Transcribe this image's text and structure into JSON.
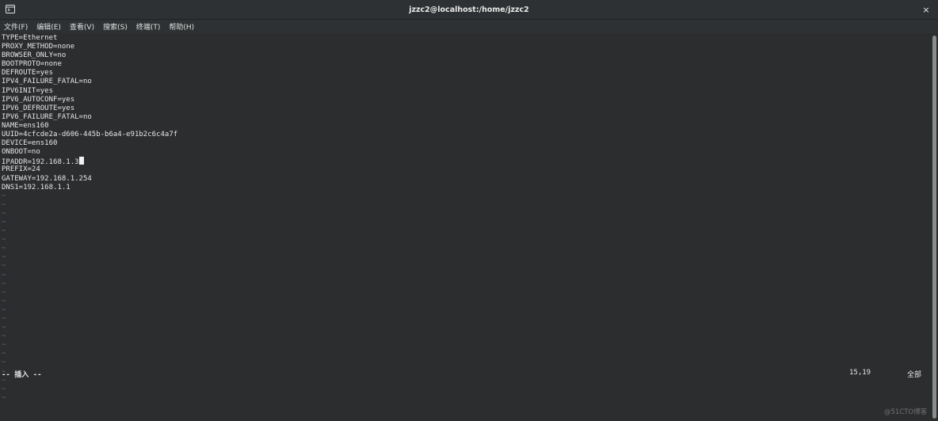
{
  "window": {
    "title": "jzzc2@localhost:/home/jzzc2",
    "close_glyph": "×",
    "icon": "terminal-icon"
  },
  "menu": [
    "文件(F)",
    "编辑(E)",
    "查看(V)",
    "搜索(S)",
    "终端(T)",
    "帮助(H)"
  ],
  "editor": {
    "lines": [
      "TYPE=Ethernet",
      "PROXY_METHOD=none",
      "BROWSER_ONLY=no",
      "BOOTPROTO=none",
      "DEFROUTE=yes",
      "IPV4_FAILURE_FATAL=no",
      "IPV6INIT=yes",
      "IPV6_AUTOCONF=yes",
      "IPV6_DEFROUTE=yes",
      "IPV6_FAILURE_FATAL=no",
      "NAME=ens160",
      "UUID=4cfcde2a-d606-445b-b6a4-e91b2c6c4a7f",
      "DEVICE=ens160",
      "ONBOOT=no",
      "IPADDR=192.168.1.3",
      "PREFIX=24",
      "GATEWAY=192.168.1.254",
      "DNS1=192.168.1.1"
    ],
    "cursor_line_index": 14,
    "empty_marker": "~",
    "empty_marker_count": 24
  },
  "status": {
    "mode": "-- 插入 --",
    "position": "15,19",
    "scroll": "全部"
  },
  "watermark": "@51CTO博客",
  "colors": {
    "background": "#2b2d2e",
    "text": "#e6e6e6",
    "tilde": "#5c6a8a",
    "cursor": "#f2f2f2"
  }
}
